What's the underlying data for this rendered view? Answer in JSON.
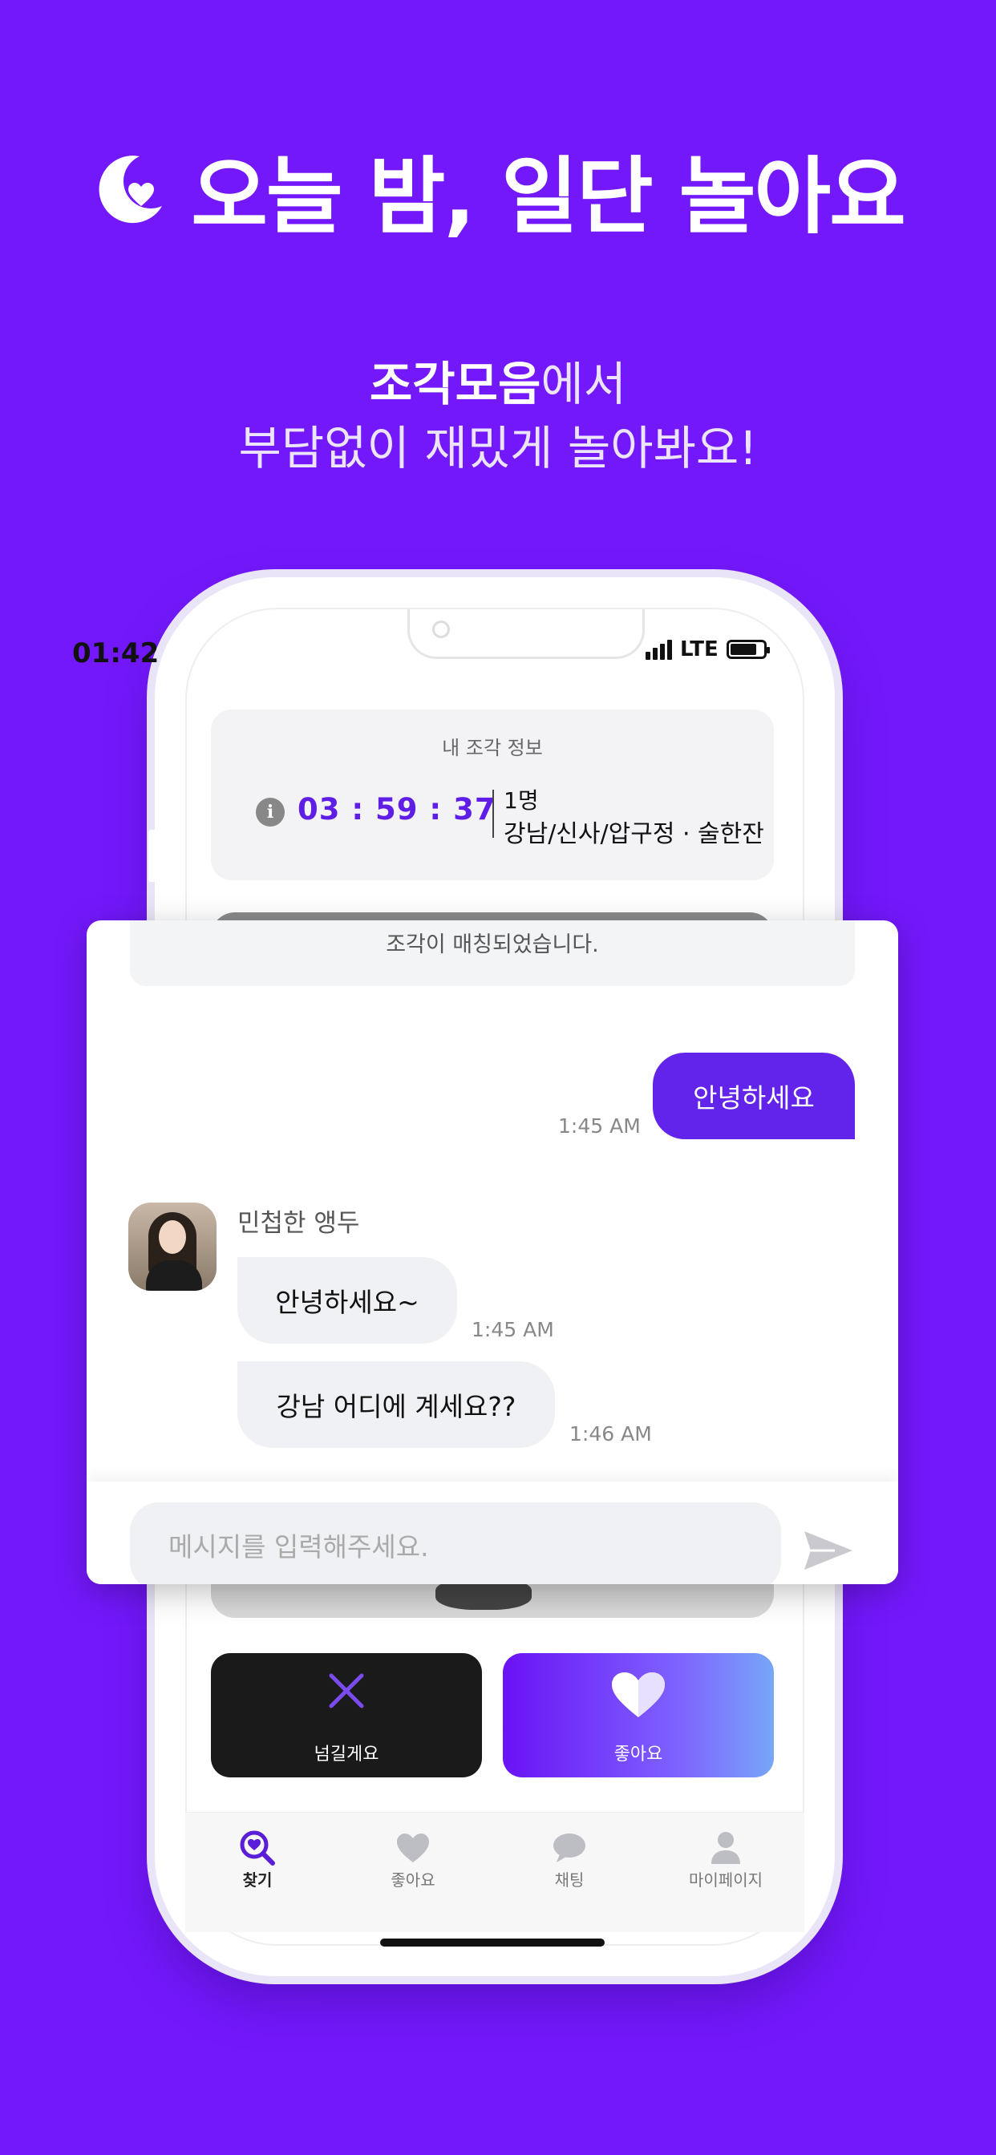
{
  "headline": {
    "text": "오늘 밤, 일단 놀아요"
  },
  "subtitle": {
    "brand": "조각모음",
    "line1_suffix": "에서",
    "line2": "부담없이 재밌게 놀아봐요!"
  },
  "status_bar": {
    "time": "01:42",
    "network": "LTE"
  },
  "info_card": {
    "title": "내 조각 정보",
    "timer": "03 : 59 : 37",
    "people_count": "1명",
    "area_tags": "강남/신사/압구정 · 술한잔"
  },
  "chat": {
    "match_notice": "조각이 매칭되었습니다.",
    "sent_message": {
      "text": "안녕하세요",
      "time": "1:45 AM"
    },
    "sender_name": "민첩한 앵두",
    "received": [
      {
        "text": "안녕하세요~",
        "time": "1:45 AM"
      },
      {
        "text": "강남 어디에 계세요??",
        "time": "1:46 AM"
      }
    ],
    "input_placeholder": "메시지를 입력해주세요."
  },
  "actions": {
    "pass_label": "넘길게요",
    "like_label": "좋아요"
  },
  "tabbar": {
    "tabs": [
      {
        "label": "찾기",
        "icon": "search-heart-icon",
        "active": true
      },
      {
        "label": "좋아요",
        "icon": "heart-icon",
        "active": false
      },
      {
        "label": "채팅",
        "icon": "chat-bubble-icon",
        "active": false
      },
      {
        "label": "마이페이지",
        "icon": "person-icon",
        "active": false
      }
    ]
  },
  "colors": {
    "background": "#7318fb",
    "accent": "#6224ea",
    "timer": "#5f1ee6"
  }
}
